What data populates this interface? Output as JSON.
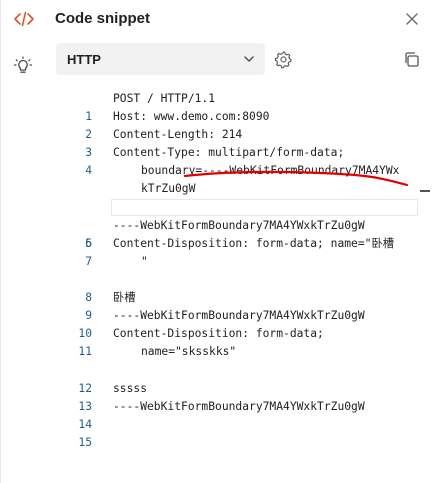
{
  "header": {
    "title": "Code snippet",
    "code_icon": "code-brackets-icon",
    "close_icon": "close-icon"
  },
  "toolbar": {
    "bulb_icon": "lightbulb-icon",
    "language": "HTTP",
    "chevron_icon": "chevron-down-icon",
    "settings_icon": "gear-icon",
    "copy_icon": "copy-icon"
  },
  "editor": {
    "lines": [
      {
        "n": "1",
        "text": "POST / HTTP/1.1"
      },
      {
        "n": "2",
        "text": "Host: www.demo.com:8090"
      },
      {
        "n": "3",
        "text": "Content-Length: 214"
      },
      {
        "n": "4",
        "text": "Content-Type: multipart/form-data;",
        "cont1": "boundary=----WebKitFormBoundary7MA4YWx",
        "cont2": "kTrZu0gW"
      },
      {
        "n": "5",
        "text": ""
      },
      {
        "n": "6",
        "text": "----WebKitFormBoundary7MA4YWxkTrZu0gW"
      },
      {
        "n": "7",
        "text": "Content-Disposition: form-data; name=\"卧槽",
        "cont1": "\""
      },
      {
        "n": "8",
        "text": ""
      },
      {
        "n": "9",
        "text": "卧槽"
      },
      {
        "n": "10",
        "text": "----WebKitFormBoundary7MA4YWxkTrZu0gW"
      },
      {
        "n": "11",
        "text": "Content-Disposition: form-data;",
        "cont1": "name=\"sksskks\""
      },
      {
        "n": "12",
        "text": ""
      },
      {
        "n": "13",
        "text": "sssss"
      },
      {
        "n": "14",
        "text": "----WebKitFormBoundary7MA4YWxkTrZu0gW"
      },
      {
        "n": "15",
        "text": ""
      }
    ]
  },
  "colors": {
    "accent_orange": "#e0512f",
    "line_number": "#1f5f8b",
    "annotation_red": "#e10000"
  }
}
